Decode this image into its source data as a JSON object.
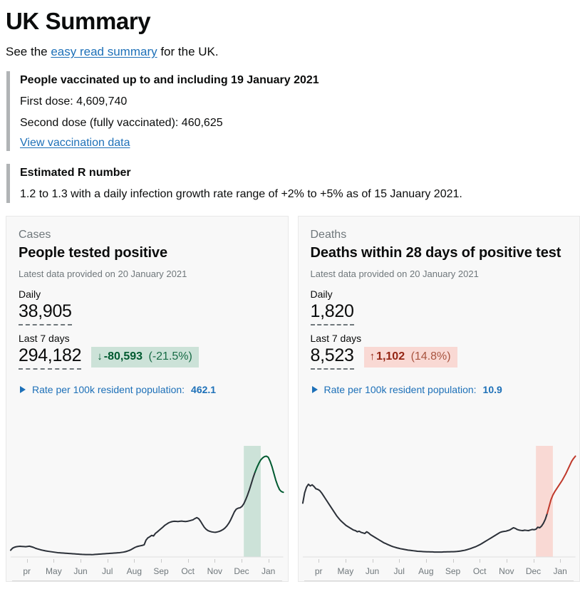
{
  "header": {
    "title": "UK Summary",
    "intro_before": "See the ",
    "intro_link": "easy read summary",
    "intro_after": " for the UK."
  },
  "vaccination": {
    "title": "People vaccinated up to and including 19 January 2021",
    "first_dose": "First dose: 4,609,740",
    "second_dose": "Second dose (fully vaccinated): 460,625",
    "link": "View vaccination data"
  },
  "r_number": {
    "title": "Estimated R number",
    "text": "1.2 to 1.3 with a daily infection growth rate range of +2% to +5% as of 15 January 2021."
  },
  "cards": [
    {
      "kicker": "Cases",
      "title": "People tested positive",
      "subtitle": "Latest data provided on 20 January 2021",
      "daily_label": "Daily",
      "daily_value": "38,905",
      "weekly_label": "Last 7 days",
      "weekly_value": "294,182",
      "change_arrow": "↓",
      "change_value": "-80,593",
      "change_pct": "(-21.5%)",
      "change_direction": "down",
      "rate_label": "Rate per 100k resident population:",
      "rate_value": "462.1",
      "accent": "#005a30",
      "band_color": "#cce2d8"
    },
    {
      "kicker": "Deaths",
      "title": "Deaths within 28 days of positive test",
      "subtitle": "Latest data provided on 20 January 2021",
      "daily_label": "Daily",
      "daily_value": "1,820",
      "weekly_label": "Last 7 days",
      "weekly_value": "8,523",
      "change_arrow": "↑",
      "change_value": "1,102",
      "change_pct": "(14.8%)",
      "change_direction": "up",
      "rate_label": "Rate per 100k resident population:",
      "rate_value": "10.9",
      "accent": "#c0392b",
      "band_color": "#f9d9d4"
    }
  ],
  "chart_data": [
    {
      "type": "line",
      "title": "People tested positive",
      "xlabel": "",
      "ylabel": "",
      "tick_labels": [
        "pr",
        "May",
        "Jun",
        "Jul",
        "Aug",
        "Sep",
        "Oct",
        "Nov",
        "Dec",
        "Jan"
      ],
      "line_color": "#2b3038",
      "highlight_color": "#005a30",
      "band_color": "#cce2d8",
      "values": [
        5.0,
        6.5,
        7.2,
        7.6,
        7.8,
        7.9,
        7.8,
        7.7,
        7.6,
        7.8,
        8.0,
        7.6,
        7.2,
        6.6,
        6.1,
        5.7,
        5.3,
        5.0,
        4.7,
        4.4,
        4.2,
        4.0,
        3.8,
        3.6,
        3.4,
        3.2,
        3.1,
        3.0,
        2.9,
        2.8,
        2.7,
        2.6,
        2.5,
        2.4,
        2.3,
        2.2,
        2.1,
        2.0,
        1.9,
        1.85,
        1.8,
        1.78,
        1.76,
        1.75,
        1.8,
        1.9,
        2.0,
        2.1,
        2.2,
        2.3,
        2.4,
        2.5,
        2.6,
        2.7,
        2.8,
        2.9,
        3.0,
        3.1,
        3.2,
        3.4,
        3.6,
        3.9,
        4.3,
        4.8,
        5.4,
        6.2,
        7.0,
        7.6,
        8.0,
        8.3,
        8.6,
        9.0,
        12.5,
        14.2,
        15.0,
        16.0,
        15.6,
        17.5,
        18.6,
        19.8,
        21.0,
        22.2,
        23.5,
        24.4,
        25.3,
        25.9,
        26.3,
        26.5,
        26.4,
        26.3,
        26.5,
        26.6,
        26.4,
        26.3,
        26.5,
        26.8,
        27.2,
        27.6,
        28.5,
        29.2,
        28.4,
        26.5,
        24.2,
        22.0,
        20.5,
        19.5,
        19.0,
        18.6,
        18.4,
        18.3,
        18.6,
        19.0,
        19.6,
        20.4,
        21.5,
        23.0,
        25.0,
        27.5,
        30.5,
        33.5,
        35.5,
        36.2,
        36.5,
        37.5,
        39.5,
        42.5,
        46.0,
        50.0,
        54.5,
        59.0,
        63.0,
        66.5,
        69.5,
        72.0,
        73.5,
        74.5,
        74.8,
        74.0,
        71.0,
        67.0,
        62.0,
        57.0,
        53.0,
        50.0,
        48.5,
        48.0
      ],
      "highlight_start_index": 130,
      "band_start_index": 124,
      "band_end_index": 133
    },
    {
      "type": "line",
      "title": "Deaths within 28 days of positive test",
      "xlabel": "",
      "ylabel": "",
      "tick_labels": [
        "pr",
        "May",
        "Jun",
        "Jul",
        "Aug",
        "Sep",
        "Oct",
        "Nov",
        "Dec",
        "Jan"
      ],
      "line_color": "#2b3038",
      "highlight_color": "#c0392b",
      "band_color": "#f9d9d4",
      "values": [
        47.0,
        56.0,
        61.0,
        63.5,
        62.0,
        63.0,
        61.5,
        59.5,
        59.0,
        58.0,
        56.0,
        53.5,
        51.0,
        48.5,
        46.0,
        43.5,
        41.0,
        38.5,
        36.0,
        34.0,
        32.0,
        30.5,
        29.0,
        27.5,
        26.5,
        25.5,
        24.5,
        23.5,
        23.0,
        22.0,
        22.5,
        21.5,
        21.0,
        20.5,
        22.0,
        21.0,
        19.5,
        18.5,
        17.5,
        16.5,
        15.5,
        14.5,
        13.5,
        12.5,
        11.8,
        11.0,
        10.3,
        9.6,
        9.0,
        8.5,
        8.0,
        7.6,
        7.2,
        6.9,
        6.6,
        6.3,
        6.0,
        5.8,
        5.6,
        5.4,
        5.2,
        5.0,
        4.9,
        4.8,
        4.7,
        4.6,
        4.5,
        4.5,
        4.4,
        4.4,
        4.3,
        4.3,
        4.3,
        4.3,
        4.3,
        4.4,
        4.4,
        4.5,
        4.5,
        4.6,
        4.6,
        4.7,
        4.8,
        5.0,
        5.2,
        5.5,
        5.8,
        6.2,
        6.7,
        7.2,
        7.8,
        8.4,
        9.0,
        9.8,
        10.6,
        11.5,
        12.5,
        13.5,
        14.5,
        15.5,
        16.5,
        17.5,
        18.5,
        19.5,
        20.5,
        21.5,
        22.0,
        22.3,
        22.5,
        23.0,
        23.5,
        24.5,
        25.5,
        25.0,
        24.0,
        23.5,
        23.2,
        23.0,
        23.4,
        23.2,
        23.0,
        23.5,
        24.0,
        23.8,
        24.2,
        26.0,
        25.5,
        27.0,
        29.5,
        33.0,
        38.0,
        44.0,
        50.0,
        54.0,
        57.0,
        59.5,
        62.0,
        64.5,
        67.0,
        70.0,
        73.0,
        76.5,
        80.0,
        83.5,
        86.0,
        88.0
      ],
      "highlight_start_index": 130,
      "band_start_index": 124,
      "band_end_index": 133
    }
  ]
}
